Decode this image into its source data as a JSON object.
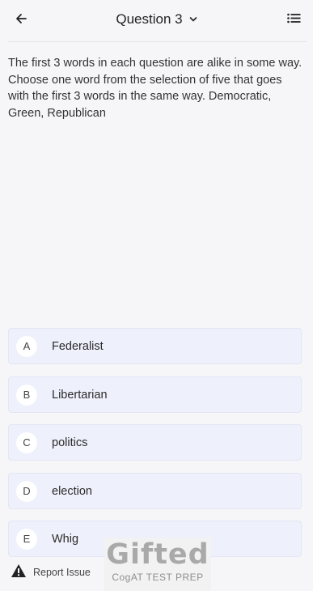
{
  "header": {
    "back_icon": "arrow-left-icon",
    "title": "Question 3",
    "dropdown_icon": "chevron-down-icon",
    "list_icon": "list-icon"
  },
  "question": {
    "text": "The first 3 words in each question are alike in some way. Choose one word from the selection of five that goes with the first 3 words in the same way. Democratic, Green, Republican"
  },
  "options": [
    {
      "letter": "A",
      "label": "Federalist"
    },
    {
      "letter": "B",
      "label": "Libertarian"
    },
    {
      "letter": "C",
      "label": "politics"
    },
    {
      "letter": "D",
      "label": "election"
    },
    {
      "letter": "E",
      "label": "Whig"
    }
  ],
  "footer": {
    "report_icon": "warning-icon",
    "report_label": "Report Issue"
  },
  "watermark": {
    "word": "Gifted",
    "sub": "CogAT TEST PREP"
  },
  "colors": {
    "background": "#f6f6f9",
    "option_bg": "#eef0fb",
    "text": "#2b2b2b"
  }
}
